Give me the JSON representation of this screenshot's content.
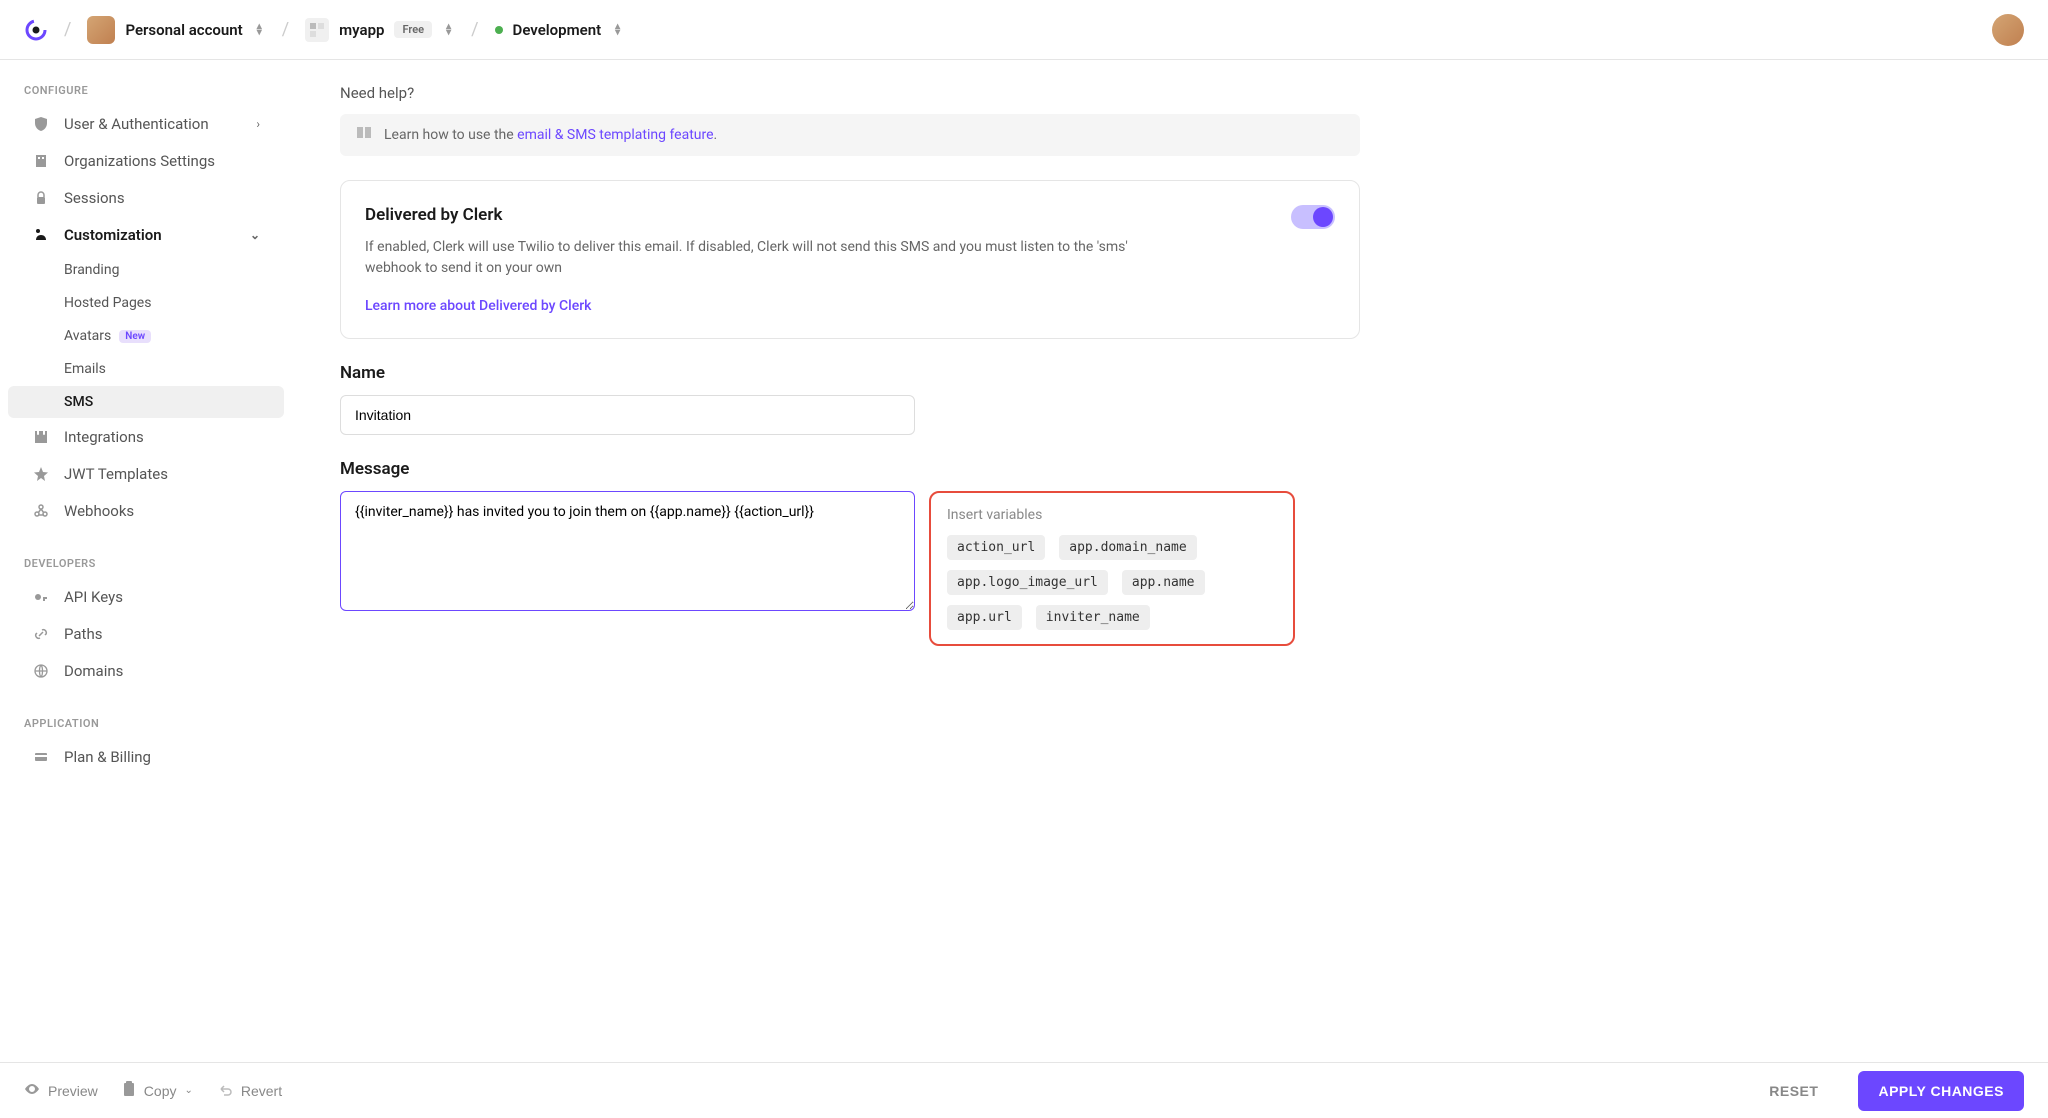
{
  "header": {
    "account": "Personal account",
    "app_name": "myapp",
    "app_tier": "Free",
    "environment": "Development"
  },
  "sidebar": {
    "section_configure": "CONFIGURE",
    "section_developers": "DEVELOPERS",
    "section_application": "APPLICATION",
    "items": {
      "user_auth": "User & Authentication",
      "orgs": "Organizations Settings",
      "sessions": "Sessions",
      "customization": "Customization",
      "branding": "Branding",
      "hosted_pages": "Hosted Pages",
      "avatars": "Avatars",
      "avatars_badge": "New",
      "emails": "Emails",
      "sms": "SMS",
      "integrations": "Integrations",
      "jwt": "JWT Templates",
      "webhooks": "Webhooks",
      "api_keys": "API Keys",
      "paths": "Paths",
      "domains": "Domains",
      "plan": "Plan & Billing"
    }
  },
  "main": {
    "help_label": "Need help?",
    "help_text": "Learn how to use the ",
    "help_link": "email & SMS templating feature",
    "card": {
      "title": "Delivered by Clerk",
      "desc": "If enabled, Clerk will use Twilio to deliver this email. If disabled, Clerk will not send this SMS and you must listen to the 'sms' webhook to send it on your own",
      "link": "Learn more about Delivered by Clerk"
    },
    "name_label": "Name",
    "name_value": "Invitation",
    "message_label": "Message",
    "message_value": "{{inviter_name}} has invited you to join them on {{app.name}} {{action_url}}",
    "vars_title": "Insert variables",
    "vars": [
      "action_url",
      "app.domain_name",
      "app.logo_image_url",
      "app.name",
      "app.url",
      "inviter_name"
    ]
  },
  "footer": {
    "preview": "Preview",
    "copy": "Copy",
    "revert": "Revert",
    "reset": "RESET",
    "apply": "APPLY CHANGES"
  }
}
